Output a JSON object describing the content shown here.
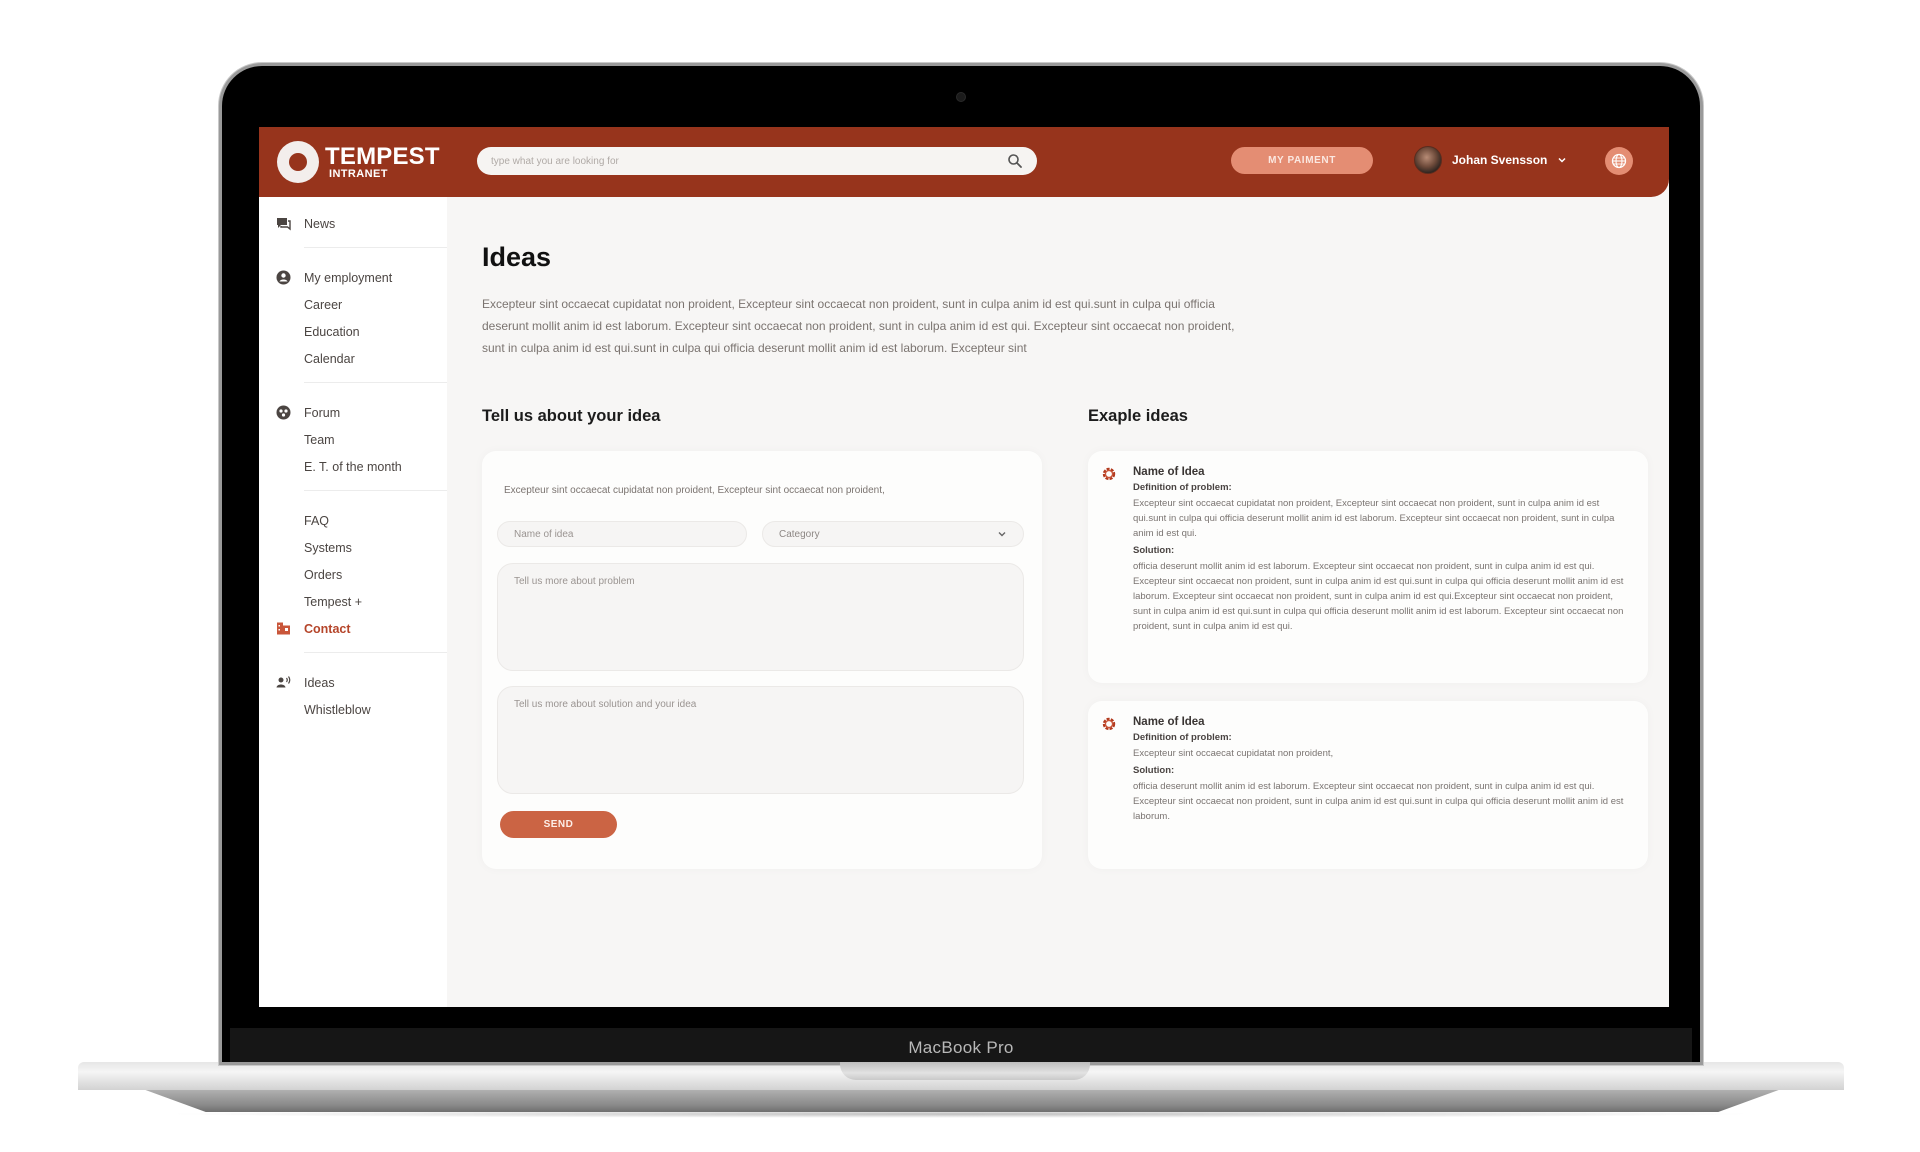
{
  "device": {
    "label": "MacBook Pro"
  },
  "header": {
    "logo_title": "TEMPEST",
    "logo_subtitle": "INTRANET",
    "search_placeholder": "type what you are looking for",
    "payment_button": "MY PAIMENT",
    "user_name": "Johan Svensson"
  },
  "colors": {
    "brand": "#97341c",
    "accent": "#cb6444",
    "accent_light": "#e48d73",
    "active_nav": "#b5452a"
  },
  "sidebar": {
    "groups": [
      {
        "items": [
          {
            "label": "News",
            "icon": "chat-icon"
          }
        ]
      },
      {
        "items": [
          {
            "label": "My employment",
            "icon": "user-circle-icon"
          },
          {
            "label": "Career"
          },
          {
            "label": "Education"
          },
          {
            "label": "Calendar"
          }
        ]
      },
      {
        "items": [
          {
            "label": "Forum",
            "icon": "group-icon"
          },
          {
            "label": "Team"
          },
          {
            "label": "E. T. of the month"
          }
        ]
      },
      {
        "items": [
          {
            "label": "FAQ"
          },
          {
            "label": "Systems"
          },
          {
            "label": "Orders"
          },
          {
            "label": "Tempest +"
          },
          {
            "label": "Contact",
            "icon": "building-icon",
            "active": true
          }
        ]
      },
      {
        "items": [
          {
            "label": "Ideas",
            "icon": "speaker-person-icon"
          },
          {
            "label": "Whistleblow"
          }
        ]
      }
    ]
  },
  "main": {
    "title": "Ideas",
    "intro": "Excepteur sint occaecat cupidatat non proident, Excepteur sint occaecat non proident, sunt in culpa anim id est qui.sunt in culpa qui officia deserunt mollit anim id est laborum. Excepteur sint occaecat non proident, sunt in culpa anim id est qui. Excepteur sint occaecat non proident, sunt in culpa anim id est qui.sunt in culpa qui officia deserunt mollit anim id est laborum. Excepteur sint",
    "form": {
      "title": "Tell us about your idea",
      "description": "Excepteur sint occaecat cupidatat non proident, Excepteur sint occaecat non proident,",
      "name_placeholder": "Name of idea",
      "category_placeholder": "Category",
      "problem_placeholder": "Tell us more about problem",
      "solution_placeholder": "Tell us more about solution and your idea",
      "send_label": "SEND"
    },
    "examples": {
      "title": "Exaple ideas",
      "items": [
        {
          "name": "Name of Idea",
          "problem_label": "Definition of problem:",
          "problem": "Excepteur sint occaecat cupidatat non proident, Excepteur sint occaecat non proident, sunt in culpa anim id est qui.sunt in culpa qui officia deserunt mollit anim id est laborum. Excepteur sint occaecat non proident, sunt in culpa anim id est qui.",
          "solution_label": "Solution:",
          "solution": "officia deserunt mollit anim id est laborum. Excepteur sint occaecat non proident, sunt in culpa anim id est qui. Excepteur sint occaecat non proident, sunt in culpa anim id est qui.sunt in culpa qui officia deserunt mollit anim id est laborum. Excepteur sint occaecat non proident, sunt in culpa anim id est qui.Excepteur sint occaecat non proident, sunt in culpa anim id est qui.sunt in culpa qui officia deserunt mollit anim id est laborum. Excepteur sint occaecat non proident, sunt in culpa anim id est qui."
        },
        {
          "name": "Name of Idea",
          "problem_label": "Definition of problem:",
          "problem": "Excepteur sint occaecat cupidatat non proident,",
          "solution_label": "Solution:",
          "solution": "officia deserunt mollit anim id est laborum. Excepteur sint occaecat non proident, sunt in culpa anim id est qui. Excepteur sint occaecat non proident, sunt in culpa anim id est qui.sunt in culpa qui officia deserunt mollit anim id est laborum."
        }
      ]
    }
  }
}
